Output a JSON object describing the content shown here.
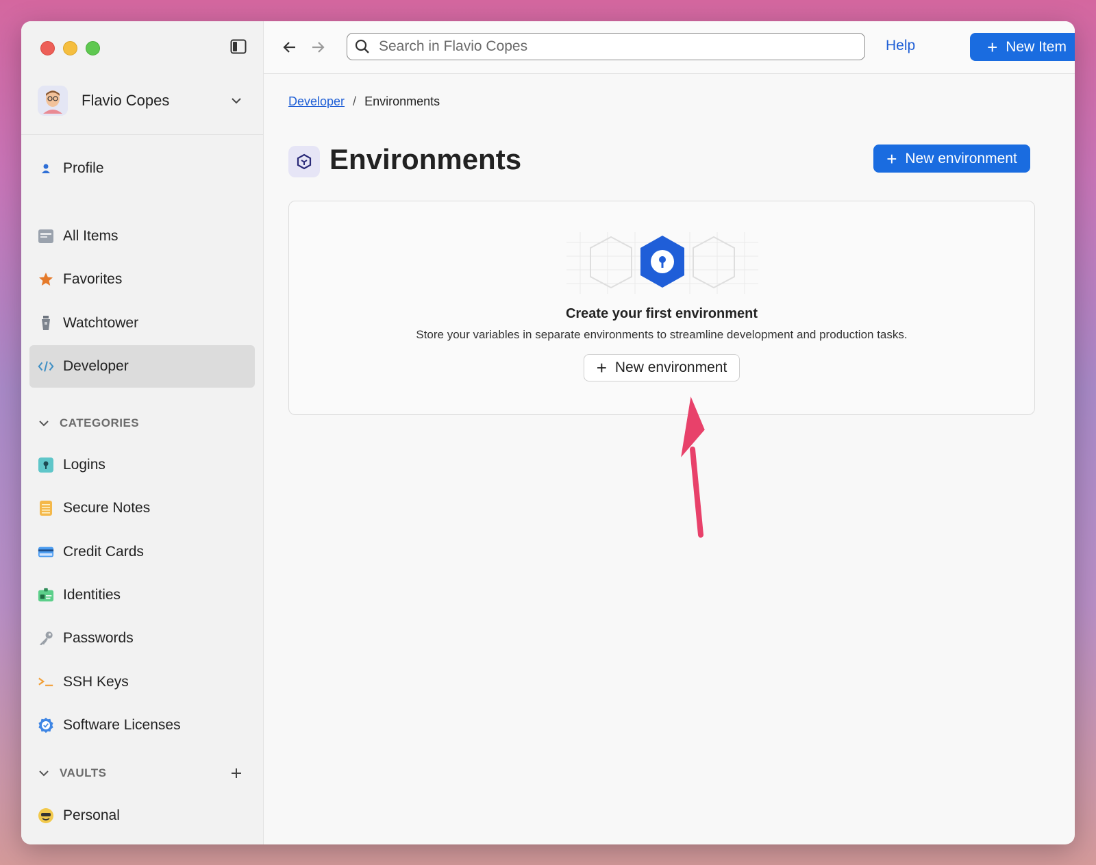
{
  "account": {
    "name": "Flavio Copes"
  },
  "sidebar": {
    "top_items": [
      {
        "label": "Profile"
      },
      {
        "label": "All Items"
      },
      {
        "label": "Favorites"
      },
      {
        "label": "Watchtower"
      },
      {
        "label": "Developer",
        "active": true
      }
    ],
    "categories_header": "CATEGORIES",
    "categories": [
      {
        "label": "Logins"
      },
      {
        "label": "Secure Notes"
      },
      {
        "label": "Credit Cards"
      },
      {
        "label": "Identities"
      },
      {
        "label": "Passwords"
      },
      {
        "label": "SSH Keys"
      },
      {
        "label": "Software Licenses"
      }
    ],
    "vaults_header": "VAULTS",
    "vaults": [
      {
        "label": "Personal"
      }
    ]
  },
  "toolbar": {
    "search_placeholder": "Search in Flavio Copes",
    "help_label": "Help",
    "new_item_label": "New Item"
  },
  "breadcrumb": {
    "parent": "Developer",
    "separator": "/",
    "current": "Environments"
  },
  "page": {
    "title": "Environments",
    "new_environment_label": "New environment"
  },
  "empty_state": {
    "title": "Create your first environment",
    "subtitle": "Store your variables in separate environments to streamline development and production tasks.",
    "button_label": "New environment"
  },
  "colors": {
    "accent": "#1a6ce0",
    "annotation_arrow": "#e8416a",
    "active_item_bg": "#dcdcdc"
  }
}
